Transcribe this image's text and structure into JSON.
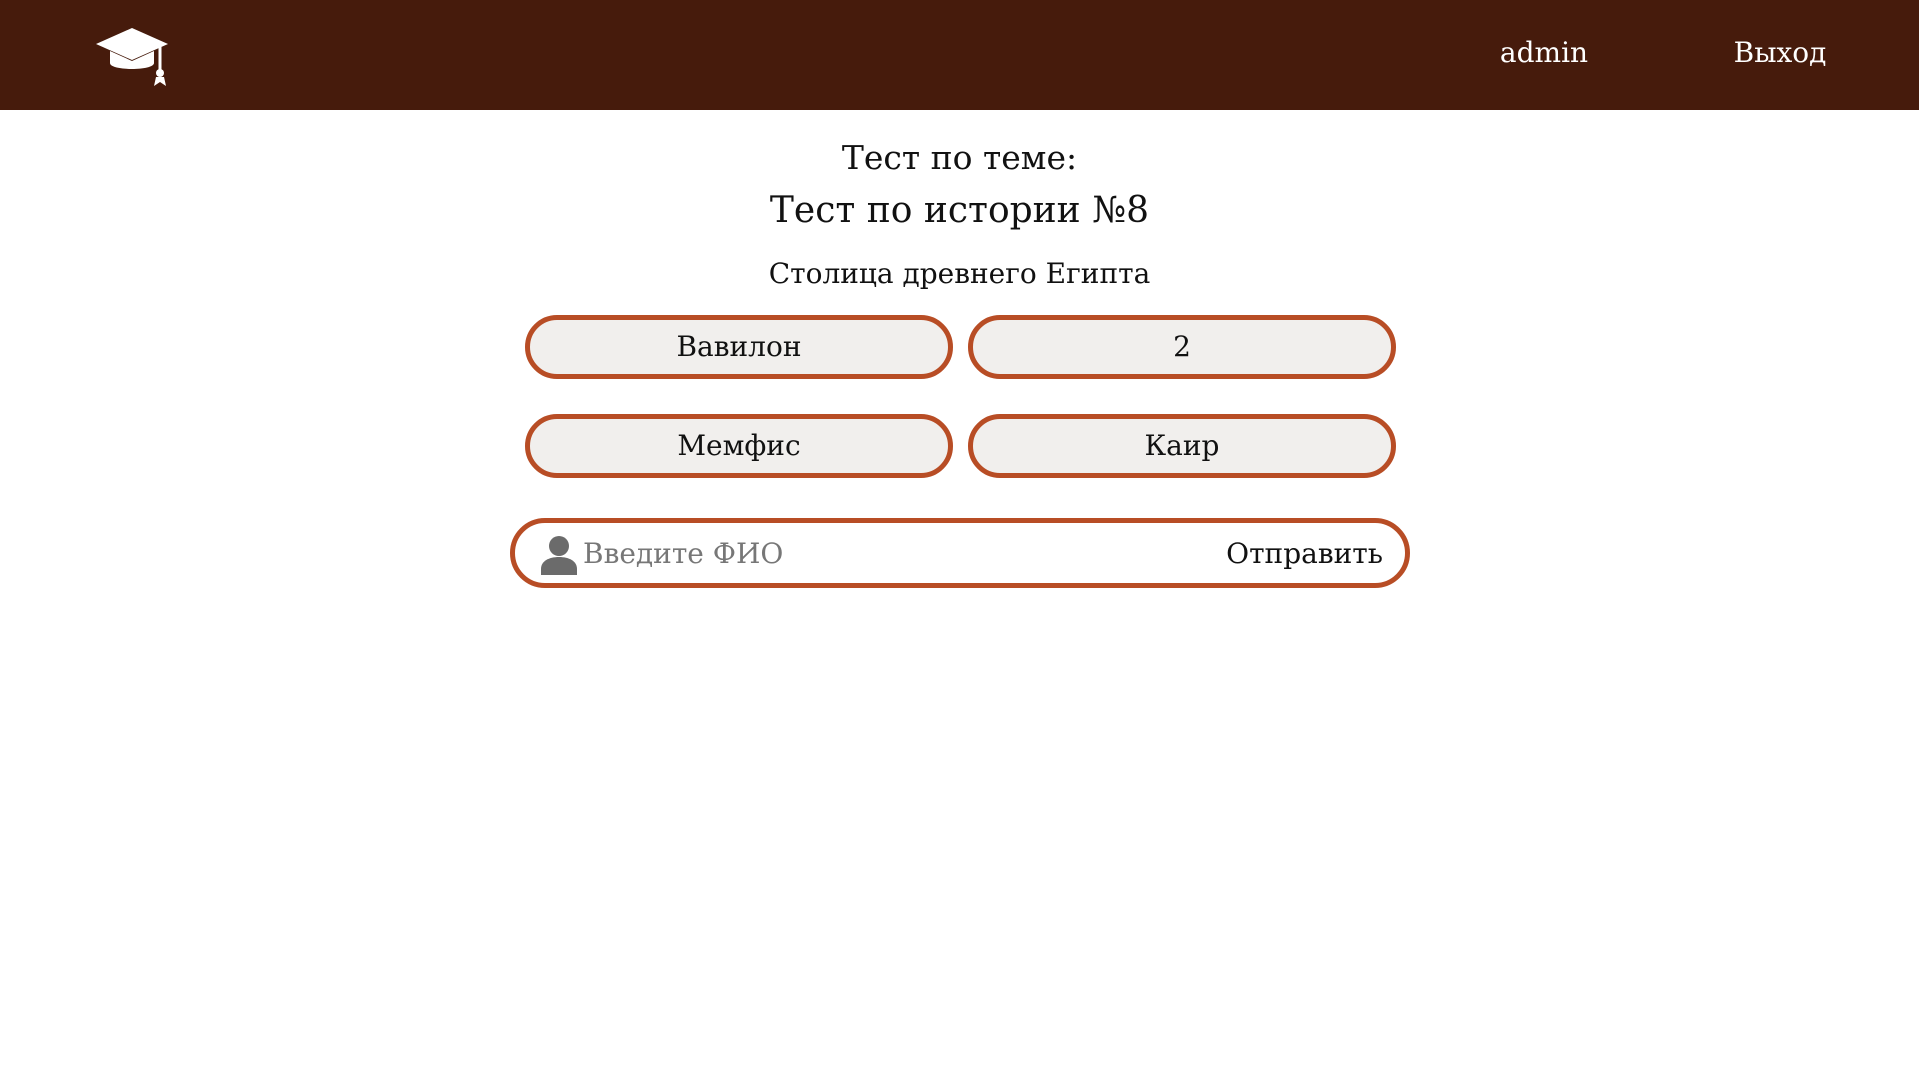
{
  "header": {
    "logo_icon": "graduation-cap-icon",
    "user_label": "admin",
    "logout_label": "Выход",
    "background_color": "#461b0c"
  },
  "test": {
    "heading": "Тест по теме:",
    "name": "Тест по истории №8",
    "question": "Столица древнего Египта",
    "answers": [
      "Вавилон",
      "2",
      "Мемфис",
      "Каир"
    ]
  },
  "form": {
    "user_icon": "user-icon",
    "fio_placeholder": "Введите ФИО",
    "fio_value": "",
    "submit_label": "Отправить"
  },
  "colors": {
    "accent": "#b84d25",
    "button_fill": "#f1efed"
  }
}
